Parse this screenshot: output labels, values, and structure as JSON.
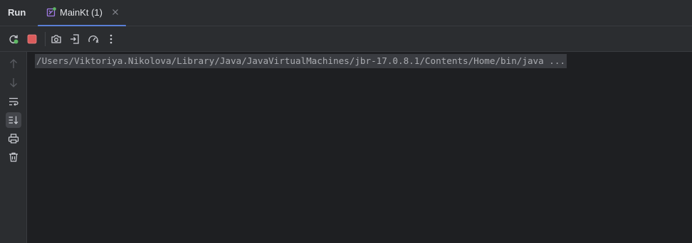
{
  "header": {
    "title": "Run",
    "tab": {
      "label": "MainKt (1)",
      "icon": "kotlin-run-config-icon",
      "close_icon": "close-icon"
    }
  },
  "toolbar": {
    "buttons": [
      "rerun-icon",
      "stop-icon",
      "screenshot-icon",
      "exit-icon",
      "profiler-icon",
      "more-icon"
    ]
  },
  "gutter": {
    "buttons": [
      "arrow-up-icon",
      "arrow-down-icon",
      "soft-wrap-icon",
      "scroll-to-end-icon",
      "print-icon",
      "trash-icon"
    ]
  },
  "console": {
    "command": "/Users/Viktoriya.Nikolova/Library/Java/JavaVirtualMachines/jbr-17.0.8.1/Contents/Home/bin/java ..."
  },
  "colors": {
    "background": "#1e1f22",
    "panel": "#2b2d30",
    "accent": "#5a7fd6",
    "stop": "#db5c5c",
    "run_dot": "#5fb865"
  }
}
